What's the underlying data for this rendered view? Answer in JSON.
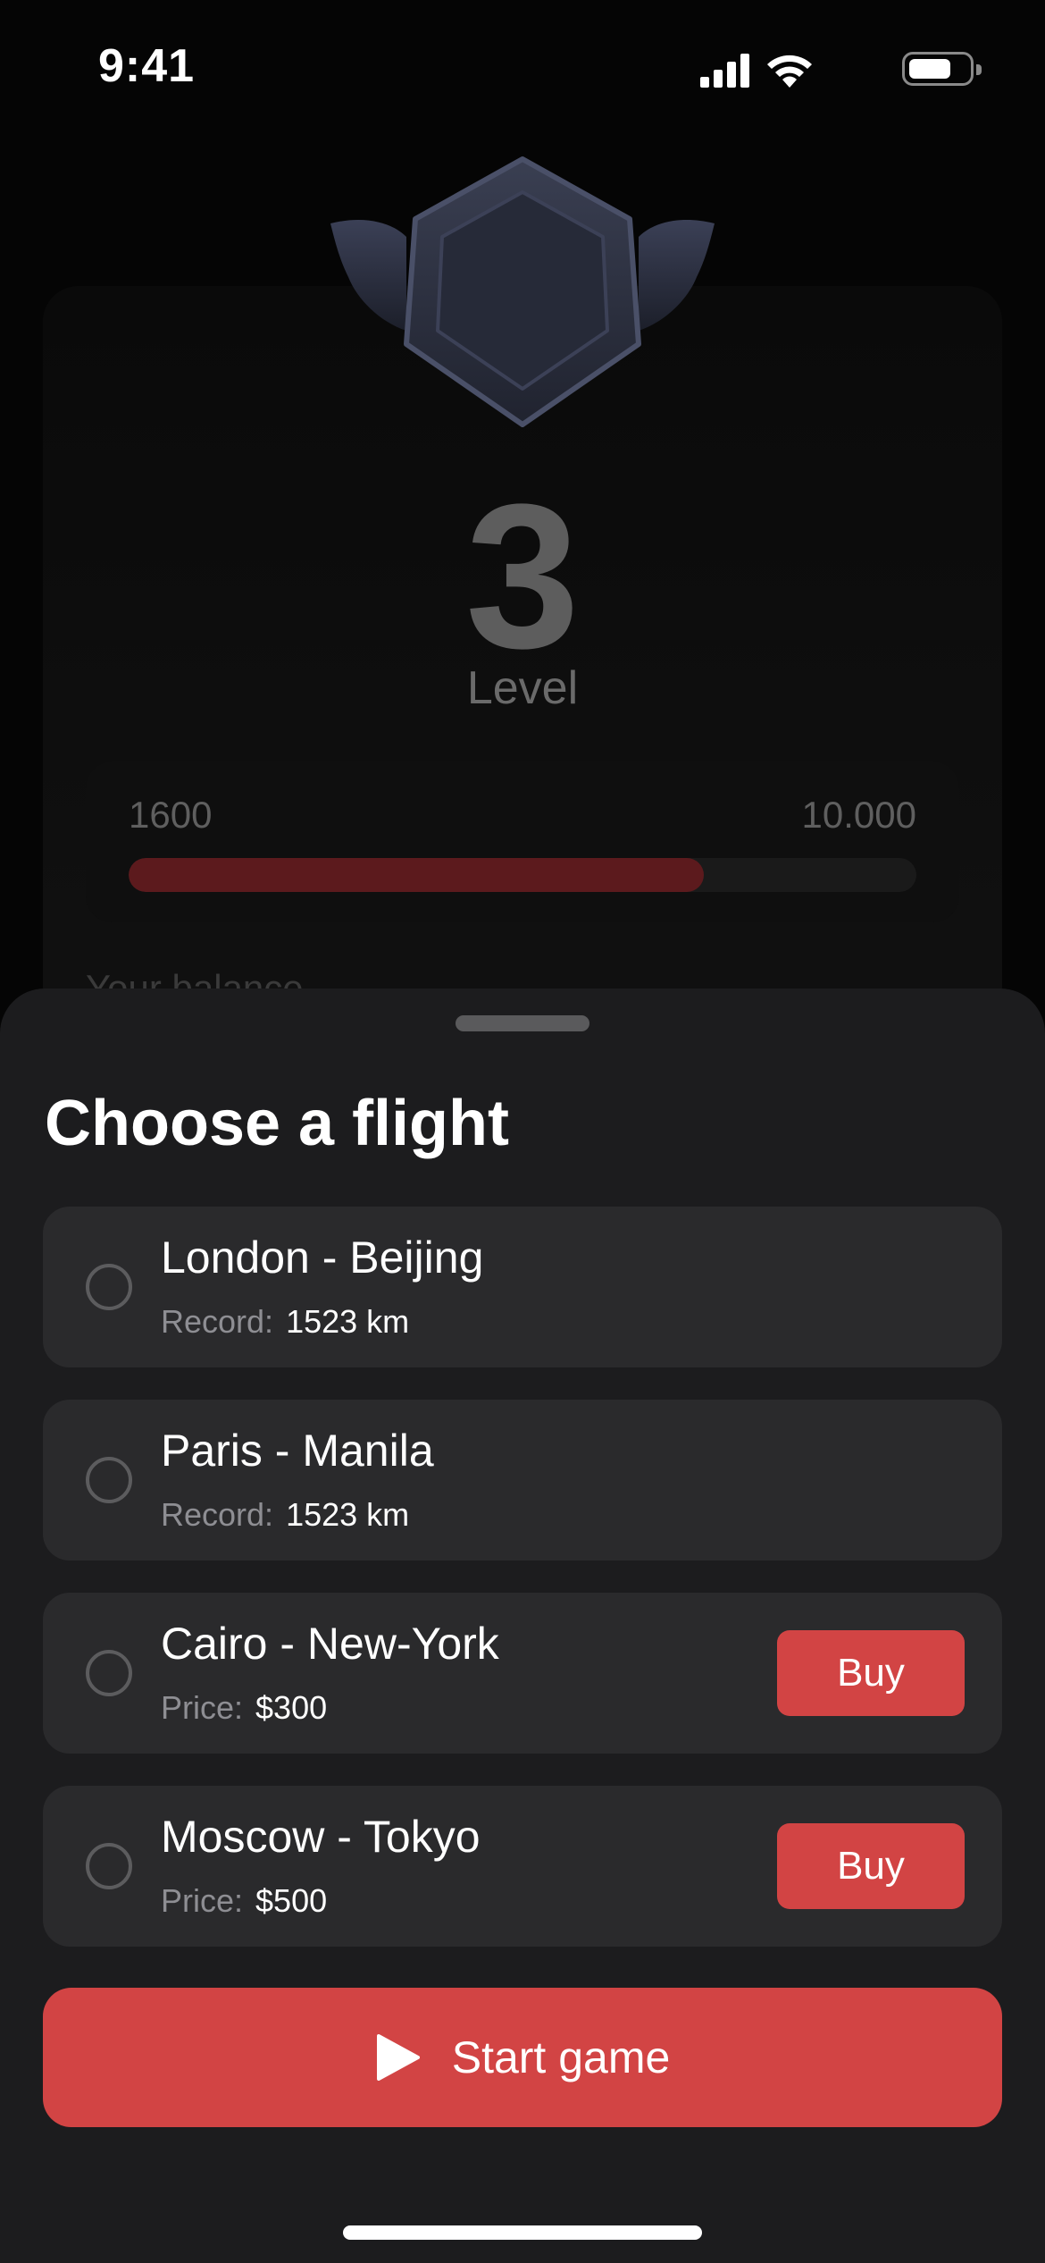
{
  "status_bar": {
    "time": "9:41"
  },
  "level": {
    "number": "3",
    "label": "Level"
  },
  "progress": {
    "min": "1600",
    "max": "10.000",
    "fill_fraction": 0.73
  },
  "balance_peek": "Your balance",
  "sheet": {
    "title": "Choose a flight",
    "flights": [
      {
        "route": "London - Beijing",
        "meta_label": "Record:",
        "meta_value": "1523 km",
        "buy": null
      },
      {
        "route": "Paris - Manila",
        "meta_label": "Record:",
        "meta_value": "1523 km",
        "buy": null
      },
      {
        "route": "Cairo - New-York",
        "meta_label": "Price:",
        "meta_value": "$300",
        "buy": "Buy"
      },
      {
        "route": "Moscow - Tokyo",
        "meta_label": "Price:",
        "meta_value": "$500",
        "buy": "Buy"
      }
    ],
    "start_label": "Start game"
  },
  "colors": {
    "accent": "#d24444",
    "sheet_bg": "#1c1c1e",
    "item_bg": "#2a2a2c",
    "progress_fill": "#5c1a1d"
  },
  "icons": {
    "signal": "cellular-signal-icon",
    "wifi": "wifi-icon",
    "battery": "battery-icon",
    "badge": "winged-hexagon-badge-icon",
    "play": "play-icon"
  }
}
